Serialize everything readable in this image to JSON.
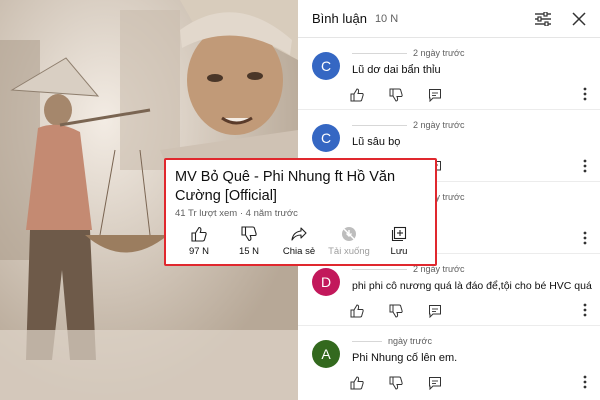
{
  "panel": {
    "title": "Bình luận",
    "count": "10 N",
    "icons": [
      "filter-icon",
      "close-icon"
    ]
  },
  "comments": [
    {
      "initial": "C",
      "avatar_color": "#3567c3",
      "time": "2 ngày trước",
      "text": "Lũ dơ dai bẩn thỉu"
    },
    {
      "initial": "C",
      "avatar_color": "#3567c3",
      "time": "2 ngày trước",
      "text": "Lũ sâu bọ"
    },
    {
      "initial": "",
      "avatar_color": "#3567c3",
      "time": "2 ngày trước",
      "text": ""
    },
    {
      "initial": "D",
      "avatar_color": "#c2185b",
      "time": "2 ngày trước",
      "text": "phi phi cô nương quá là đáo để,tội cho bé HVC quá"
    },
    {
      "initial": "A",
      "avatar_color": "#33691e",
      "time": "ngày trước",
      "text": "Phi Nhung cố lên em."
    }
  ],
  "video_info": {
    "title": "MV Bỏ Quê - Phi Nhung ft Hồ Văn Cường [Official]",
    "views_date": "41 Tr lượt xem · 4 năm trước",
    "actions": [
      {
        "label": "97 N",
        "icon": "thumbs-up-icon",
        "enabled": true
      },
      {
        "label": "15 N",
        "icon": "thumbs-down-icon",
        "enabled": true
      },
      {
        "label": "Chia sẻ",
        "icon": "share-icon",
        "enabled": true
      },
      {
        "label": "Tải xuống",
        "icon": "download-icon",
        "enabled": false
      },
      {
        "label": "Lưu",
        "icon": "save-playlist-icon",
        "enabled": true
      }
    ]
  },
  "colors": {
    "highlight_border": "#e0282e",
    "secondary_text": "#606060"
  }
}
